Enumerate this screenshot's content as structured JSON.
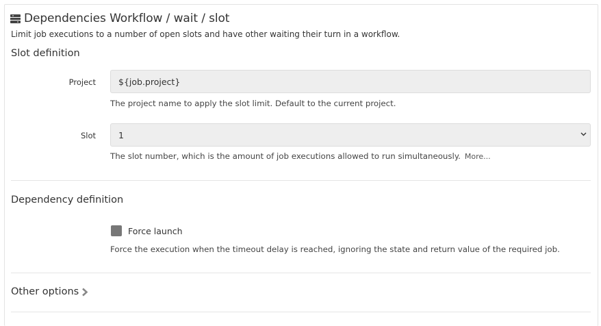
{
  "header": {
    "icon": "plugin-icon",
    "title": "Dependencies Workflow / wait / slot",
    "description": "Limit job executions to a number of open slots and have other waiting their turn in a workflow."
  },
  "slot_definition": {
    "title": "Slot definition",
    "project": {
      "label": "Project",
      "value": "${job.project}",
      "help": "The project name to apply the slot limit. Default to the current project."
    },
    "slot": {
      "label": "Slot",
      "value": "1",
      "help": "The slot number, which is the amount of job executions allowed to run simultaneously.",
      "more_link": "More..."
    }
  },
  "dependency_definition": {
    "title": "Dependency definition",
    "force_launch": {
      "label": "Force launch",
      "checked": false,
      "help": "Force the execution when the timeout delay is reached, ignoring the state and return value of the required job."
    }
  },
  "other_options": {
    "title": "Other options",
    "expanded": false
  },
  "colors": {
    "input_bg": "#eeeeee",
    "checkbox": "#777777",
    "divider": "#e5e5e5",
    "text": "#333333"
  }
}
